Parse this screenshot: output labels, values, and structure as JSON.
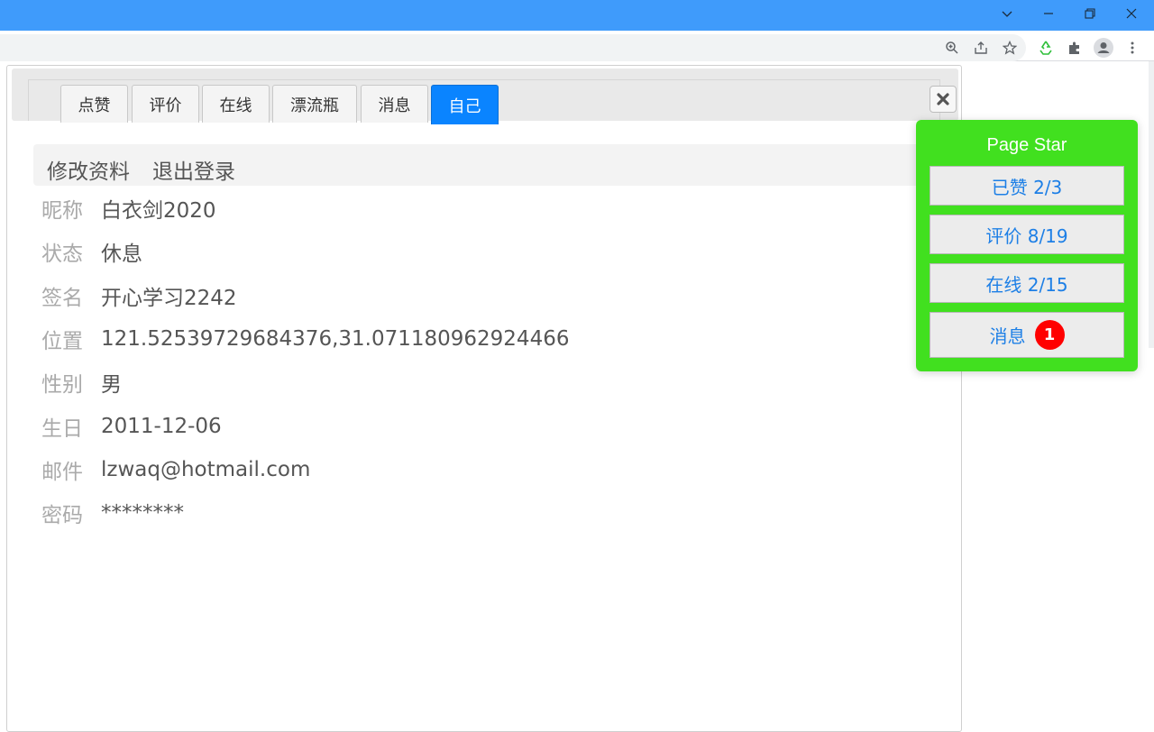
{
  "browser": {
    "window_controls": [
      "chevron-down-icon",
      "minimize-icon",
      "restore-icon",
      "close-icon"
    ],
    "toolbar_icons": [
      "zoom-icon",
      "share-icon",
      "bookmark-star-icon",
      "extension-recycle-icon",
      "puzzle-icon",
      "profile-icon",
      "more-vert-icon"
    ]
  },
  "tabs": [
    {
      "label": "点赞",
      "active": false
    },
    {
      "label": "评价",
      "active": false
    },
    {
      "label": "在线",
      "active": false
    },
    {
      "label": "漂流瓶",
      "active": false
    },
    {
      "label": "消息",
      "active": false
    },
    {
      "label": "自己",
      "active": true
    }
  ],
  "actions": {
    "edit": "修改资料",
    "logout": "退出登录"
  },
  "profile": [
    {
      "label": "昵称",
      "value": "白衣剑2020"
    },
    {
      "label": "状态",
      "value": "休息"
    },
    {
      "label": "签名",
      "value": "开心学习2242"
    },
    {
      "label": "位置",
      "value": "121.52539729684376,31.071180962924466"
    },
    {
      "label": "性别",
      "value": "男"
    },
    {
      "label": "生日",
      "value": "2011-12-06"
    },
    {
      "label": "邮件",
      "value": "lzwaq@hotmail.com"
    },
    {
      "label": "密码",
      "value": "********"
    }
  ],
  "page_star": {
    "title": "Page Star",
    "liked": "已赞  2/3",
    "reviews": "评价 8/19",
    "online": "在线 2/15",
    "messages_label": "消息",
    "messages_badge": "1"
  },
  "colors": {
    "accent": "#0a84ff",
    "popup_bg": "#41e01f",
    "badge": "#ff0000",
    "titlebar": "#3f9bfb"
  }
}
